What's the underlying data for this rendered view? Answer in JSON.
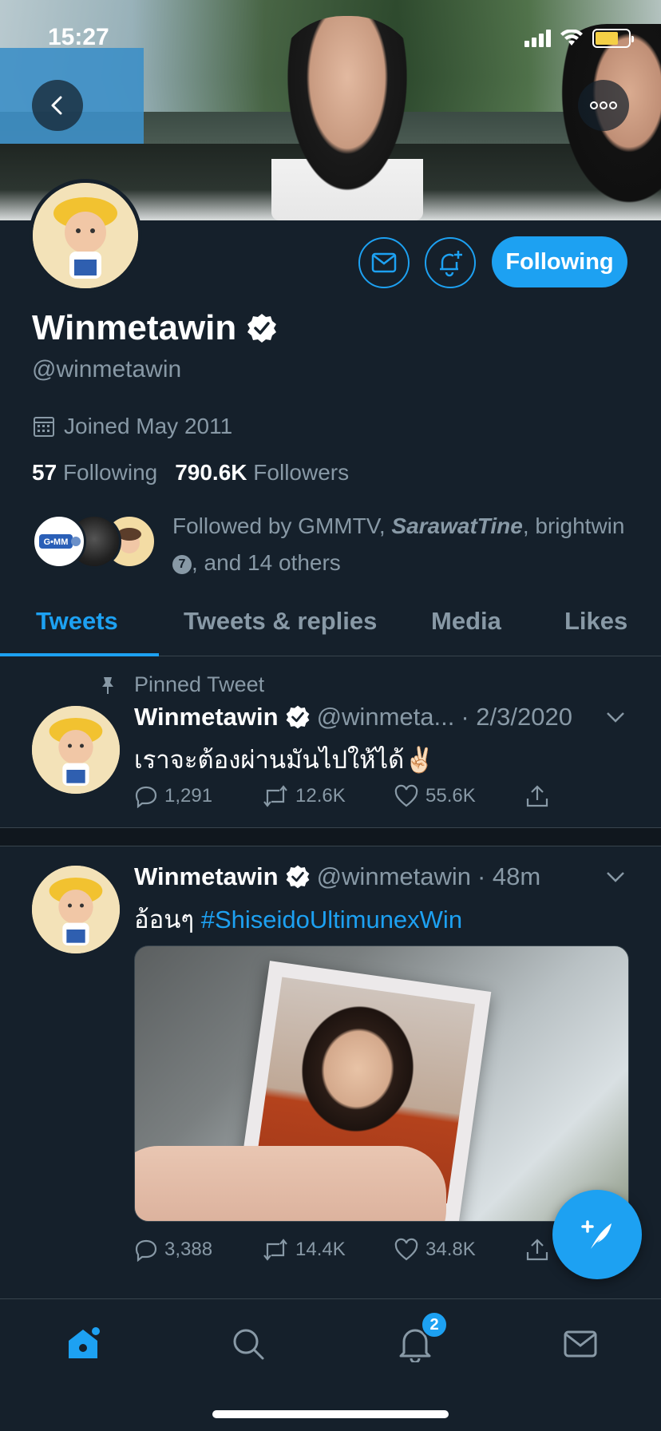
{
  "status_bar": {
    "time": "15:27"
  },
  "profile": {
    "name": "Winmetawin",
    "handle": "@winmetawin",
    "joined": "Joined May 2011",
    "following_count": "57",
    "following_label": "Following",
    "followers_count": "790.6K",
    "followers_label": "Followers",
    "follow_button": "Following",
    "followed_by_prefix": "Followed by GMMTV, ",
    "followed_by_italic": "SarawatTine",
    "followed_by_mid": ", brightwin",
    "followed_by_badge": "7",
    "followed_by_suffix": ", and 14 others"
  },
  "tabs": [
    "Tweets",
    "Tweets & replies",
    "Media",
    "Likes"
  ],
  "tweets": [
    {
      "pinned_label": "Pinned Tweet",
      "name": "Winmetawin",
      "handle": "@winmeta...",
      "time": "· 2/3/2020",
      "text": "เราจะต้องผ่านมันไปให้ได้✌🏻",
      "replies": "1,291",
      "retweets": "12.6K",
      "likes": "55.6K"
    },
    {
      "name": "Winmetawin",
      "handle": "@winmetawin",
      "time": "· 48m",
      "text": "อ้อนๆ ",
      "hashtag": "#ShiseidoUltimunexWin",
      "replies": "3,388",
      "retweets": "14.4K",
      "likes": "34.8K"
    }
  ],
  "notifications_badge": "2",
  "colors": {
    "accent": "#1da1f2",
    "background": "#15202b",
    "muted": "#8899a6",
    "divider": "#38444d"
  }
}
